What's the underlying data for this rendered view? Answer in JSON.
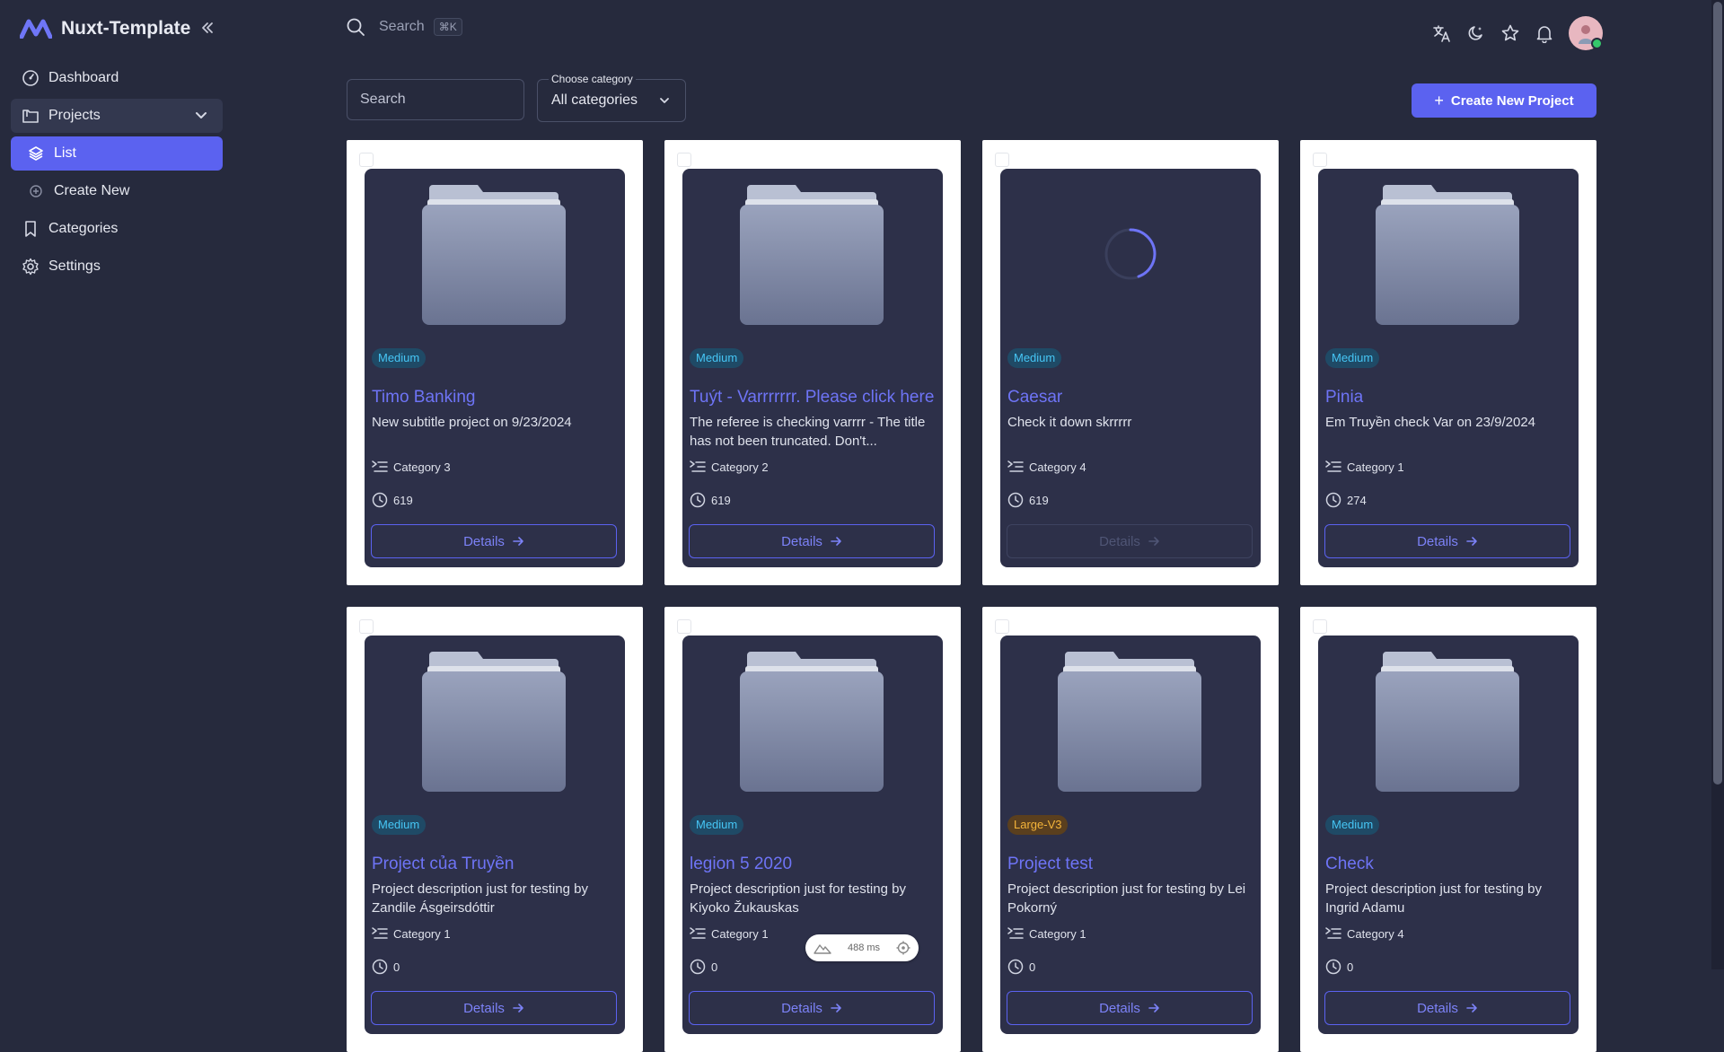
{
  "brand": {
    "name": "Nuxt-Template"
  },
  "sidebar": {
    "items": [
      {
        "label": "Dashboard",
        "icon": "dashboard-icon"
      },
      {
        "label": "Projects",
        "icon": "projects-icon"
      },
      {
        "label": "List",
        "icon": "layers-icon"
      },
      {
        "label": "Create New",
        "icon": "plus-circle-icon"
      },
      {
        "label": "Categories",
        "icon": "bookmark-icon"
      },
      {
        "label": "Settings",
        "icon": "gear-icon"
      }
    ]
  },
  "topbar": {
    "search_label": "Search",
    "shortcut": "⌘K"
  },
  "filters": {
    "search_placeholder": "Search",
    "category_label": "Choose category",
    "category_value": "All categories"
  },
  "actions": {
    "create_label": "Create New Project"
  },
  "cards": [
    {
      "badge": "Medium",
      "title": "Timo Banking",
      "subtitle": "New subtitle project on 9/23/2024",
      "category": "Category 3",
      "count": "619",
      "details": "Details",
      "loading": false
    },
    {
      "badge": "Medium",
      "title": "Tuýt - Varrrrrrr. Please click here",
      "subtitle": "The referee is checking varrrr - The title has not been truncated. Don't...",
      "category": "Category 2",
      "count": "619",
      "details": "Details",
      "loading": false
    },
    {
      "badge": "Medium",
      "title": "Caesar",
      "subtitle": "Check it down skrrrrr",
      "category": "Category 4",
      "count": "619",
      "details": "Details",
      "loading": true
    },
    {
      "badge": "Medium",
      "title": "Pinia",
      "subtitle": "Em Truyền check Var on 23/9/2024",
      "category": "Category 1",
      "count": "274",
      "details": "Details",
      "loading": false
    },
    {
      "badge": "Medium",
      "title": "Project của Truyền",
      "subtitle": "Project description just for testing by Zandile Ásgeirsdóttir",
      "category": "Category 1",
      "count": "0",
      "details": "Details",
      "loading": false
    },
    {
      "badge": "Medium",
      "title": "legion 5 2020",
      "subtitle": "Project description just for testing by Kiyoko Žukauskas",
      "category": "Category 1",
      "count": "0",
      "details": "Details",
      "loading": false
    },
    {
      "badge": "Large-V3",
      "title": "Project test",
      "subtitle": "Project description just for testing by Lei Pokorný",
      "category": "Category 1",
      "count": "0",
      "details": "Details",
      "loading": false
    },
    {
      "badge": "Medium",
      "title": "Check",
      "subtitle": "Project description just for testing by Ingrid Adamu",
      "category": "Category 4",
      "count": "0",
      "details": "Details",
      "loading": false
    }
  ],
  "devtools": {
    "timing": "488 ms"
  },
  "colors": {
    "accent": "#5b62f0",
    "background": "#262a3d",
    "card_inner": "#2d3049",
    "badge_medium": "#46c6f5",
    "badge_large": "#f4b43a"
  }
}
